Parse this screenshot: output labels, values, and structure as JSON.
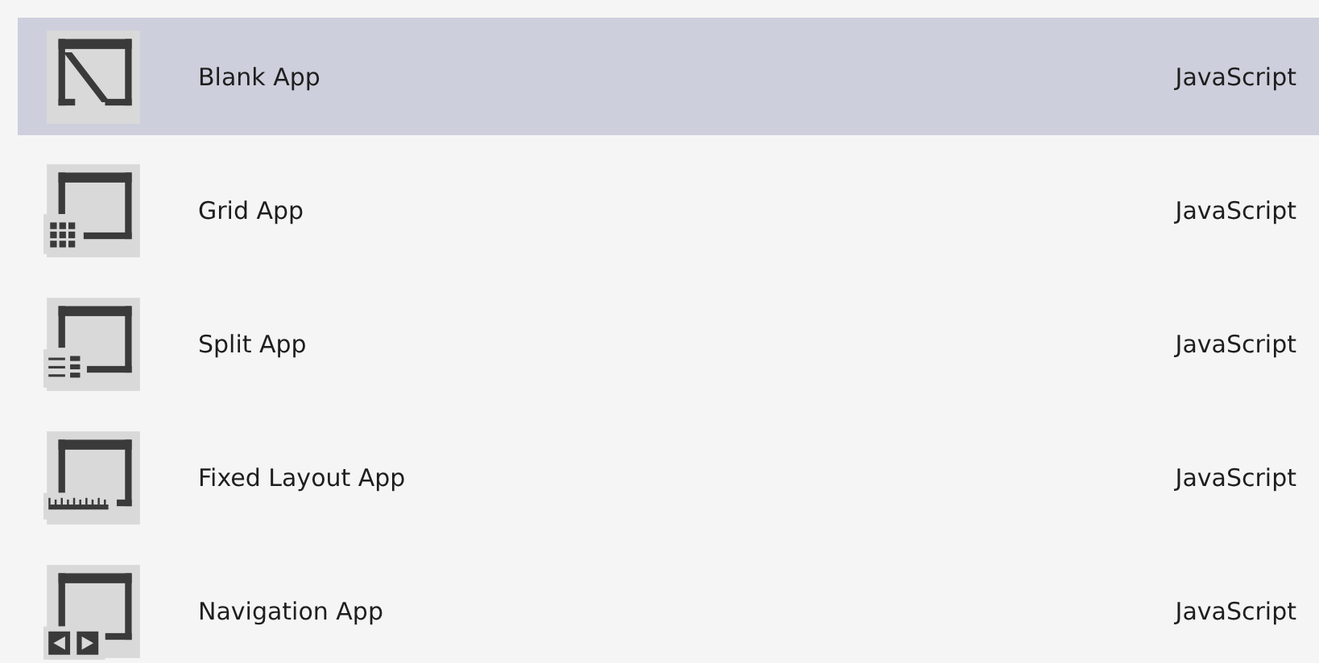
{
  "templates": [
    {
      "kind": "blank",
      "name": "Blank App",
      "language": "JavaScript",
      "selected": true
    },
    {
      "kind": "grid",
      "name": "Grid App",
      "language": "JavaScript",
      "selected": false
    },
    {
      "kind": "split",
      "name": "Split App",
      "language": "JavaScript",
      "selected": false
    },
    {
      "kind": "fixed",
      "name": "Fixed Layout App",
      "language": "JavaScript",
      "selected": false
    },
    {
      "kind": "navigation",
      "name": "Navigation App",
      "language": "JavaScript",
      "selected": false
    }
  ]
}
